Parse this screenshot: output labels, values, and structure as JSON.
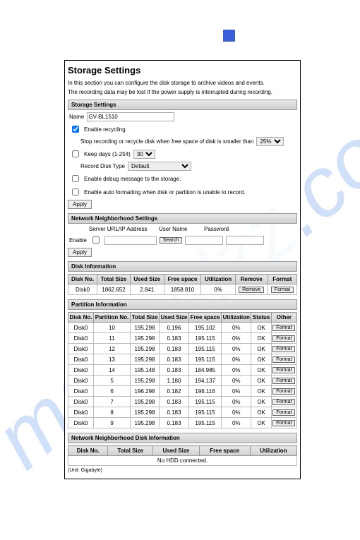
{
  "title": "Storage Settings",
  "intro1": "In this section you can configure the disk storage to archive videos and events.",
  "intro2": "The recording data may be lost if the power supply is interrupted during recording.",
  "sec_storage": "Storage Settings",
  "name_lbl": "Name",
  "name_val": "GV-BL1510",
  "enable_recycling": "Enable recycling",
  "stop_recording": "Stop recording or recycle disk when free space of disk is smaller than",
  "stop_val": "25% ",
  "keep_days": "Keep days (1-254)",
  "keep_val": "30",
  "record_type_lbl": "Record Disk Type",
  "record_type_val": "Default",
  "debug_msg": "Enable debug message to the storage.",
  "auto_format": "Enable auto formatting when disk or partition is unable to record.",
  "apply": "Apply",
  "sec_network": "Network Neighborhood Settings",
  "enable": "Enable",
  "server_url": "Server URL/IP Address",
  "username": "User Name",
  "password": "Password",
  "search": "Search",
  "sec_disk": "Disk Information",
  "disk_headers": [
    "Disk No.",
    "Total Size",
    "Used Size",
    "Free space",
    "Utilization",
    "Remove",
    "Format"
  ],
  "disk_rows": [
    [
      "Disk0",
      "1862.652",
      "2.841",
      "1858.810",
      "0%"
    ]
  ],
  "remove": "Remove",
  "format": "Format",
  "sec_partition": "Partition Information",
  "part_headers": [
    "Disk No.",
    "Partition No.",
    "Total Size",
    "Used Size",
    "Free space",
    "Utilization",
    "Status",
    "Other"
  ],
  "part_rows": [
    [
      "Disk0",
      "10",
      "195.298",
      "0.196",
      "195.102",
      "0%",
      "OK"
    ],
    [
      "Disk0",
      "11",
      "195.298",
      "0.183",
      "195.115",
      "0%",
      "OK"
    ],
    [
      "Disk0",
      "12",
      "195.298",
      "0.183",
      "195.115",
      "0%",
      "OK"
    ],
    [
      "Disk0",
      "13",
      "195.298",
      "0.183",
      "195.115",
      "0%",
      "OK"
    ],
    [
      "Disk0",
      "14",
      "195.148",
      "0.183",
      "184.985",
      "0%",
      "OK"
    ],
    [
      "Disk0",
      "5",
      "195.298",
      "1.180",
      "194.137",
      "0%",
      "OK"
    ],
    [
      "Disk0",
      "6",
      "196.298",
      "0.182",
      "196.116",
      "0%",
      "OK"
    ],
    [
      "Disk0",
      "7",
      "195.298",
      "0.183",
      "195.115",
      "0%",
      "OK"
    ],
    [
      "Disk0",
      "8",
      "195.298",
      "0.183",
      "195.115",
      "0%",
      "OK"
    ],
    [
      "Disk0",
      "9",
      "195.298",
      "0.183",
      "195.115",
      "0%",
      "OK"
    ]
  ],
  "sec_nn_disk": "Network Neighborhood Disk Information",
  "nn_headers": [
    "Disk No.",
    "Total Size",
    "Used Size",
    "Free space",
    "Utilization"
  ],
  "nn_empty": "No HDD connected.",
  "unit": "(Unit: Gigabyte)"
}
